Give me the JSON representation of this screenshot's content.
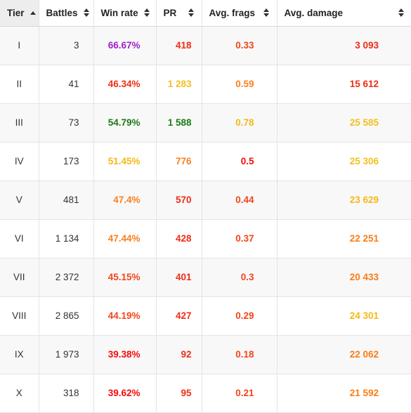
{
  "table": {
    "name": "tank-tier-statistics",
    "columns": [
      {
        "key": "tier",
        "label": "Tier",
        "sort": "asc",
        "sorted": true
      },
      {
        "key": "battles",
        "label": "Battles",
        "sort": "none",
        "sorted": false
      },
      {
        "key": "winrate",
        "label": "Win rate",
        "sort": "none",
        "sorted": false
      },
      {
        "key": "pr",
        "label": "PR",
        "sort": "none",
        "sorted": false
      },
      {
        "key": "frags",
        "label": "Avg. frags",
        "sort": "none",
        "sorted": false
      },
      {
        "key": "damage",
        "label": "Avg. damage",
        "sort": "none",
        "sorted": false
      }
    ],
    "palette": {
      "purple": "#a020c8",
      "dark_green": "#1a7a16",
      "green": "#2e8b1e",
      "gold": "#f2c01e",
      "amber": "#f5b914",
      "orange": "#f98020",
      "orange_deep": "#fa7c14",
      "red_orange": "#f4451a",
      "red": "#ef2d16",
      "pure_red": "#fa0a0a",
      "text_dark": "#333333",
      "header_text": "#222222",
      "border": "#e4e4e4",
      "row_odd_bg": "#f8f8f8",
      "row_even_bg": "#ffffff",
      "sorted_header_bg": "#ededed"
    },
    "rows": [
      {
        "tier": "I",
        "battles": "3",
        "winrate": "66.67%",
        "winrate_color": "#a020c8",
        "pr": "418",
        "pr_color": "#ef2d16",
        "frags": "0.33",
        "frags_color": "#f4451a",
        "damage": "3 093",
        "damage_color": "#ef2d16"
      },
      {
        "tier": "II",
        "battles": "41",
        "winrate": "46.34%",
        "winrate_color": "#ef2d16",
        "pr": "1 283",
        "pr_color": "#f2c01e",
        "frags": "0.59",
        "frags_color": "#f98020",
        "damage": "15 612",
        "damage_color": "#ef2d16"
      },
      {
        "tier": "III",
        "battles": "73",
        "winrate": "54.79%",
        "winrate_color": "#1a7a16",
        "pr": "1 588",
        "pr_color": "#1a7a16",
        "frags": "0.78",
        "frags_color": "#f5b914",
        "damage": "25 585",
        "damage_color": "#f2c01e"
      },
      {
        "tier": "IV",
        "battles": "173",
        "winrate": "51.45%",
        "winrate_color": "#f5b914",
        "pr": "776",
        "pr_color": "#f98020",
        "frags": "0.5",
        "frags_color": "#fa0a0a",
        "damage": "25 306",
        "damage_color": "#f2c01e"
      },
      {
        "tier": "V",
        "battles": "481",
        "winrate": "47.4%",
        "winrate_color": "#f98020",
        "pr": "570",
        "pr_color": "#ef2d16",
        "frags": "0.44",
        "frags_color": "#f4451a",
        "damage": "23 629",
        "damage_color": "#f5b914"
      },
      {
        "tier": "VI",
        "battles": "1 134",
        "winrate": "47.44%",
        "winrate_color": "#f98020",
        "pr": "428",
        "pr_color": "#ef2d16",
        "frags": "0.37",
        "frags_color": "#f4451a",
        "damage": "22 251",
        "damage_color": "#fa7c14"
      },
      {
        "tier": "VII",
        "battles": "2 372",
        "winrate": "45.15%",
        "winrate_color": "#f4451a",
        "pr": "401",
        "pr_color": "#ef2d16",
        "frags": "0.3",
        "frags_color": "#f4451a",
        "damage": "20 433",
        "damage_color": "#fa7c14"
      },
      {
        "tier": "VIII",
        "battles": "2 865",
        "winrate": "44.19%",
        "winrate_color": "#f4451a",
        "pr": "427",
        "pr_color": "#ef2d16",
        "frags": "0.29",
        "frags_color": "#f4451a",
        "damage": "24 301",
        "damage_color": "#f5b914"
      },
      {
        "tier": "IX",
        "battles": "1 973",
        "winrate": "39.38%",
        "winrate_color": "#fa0a0a",
        "pr": "92",
        "pr_color": "#ef2d16",
        "frags": "0.18",
        "frags_color": "#f4451a",
        "damage": "22 062",
        "damage_color": "#fa7c14"
      },
      {
        "tier": "X",
        "battles": "318",
        "winrate": "39.62%",
        "winrate_color": "#fa0a0a",
        "pr": "95",
        "pr_color": "#ef2d16",
        "frags": "0.21",
        "frags_color": "#f4451a",
        "damage": "21 592",
        "damage_color": "#fa7c14"
      }
    ]
  }
}
